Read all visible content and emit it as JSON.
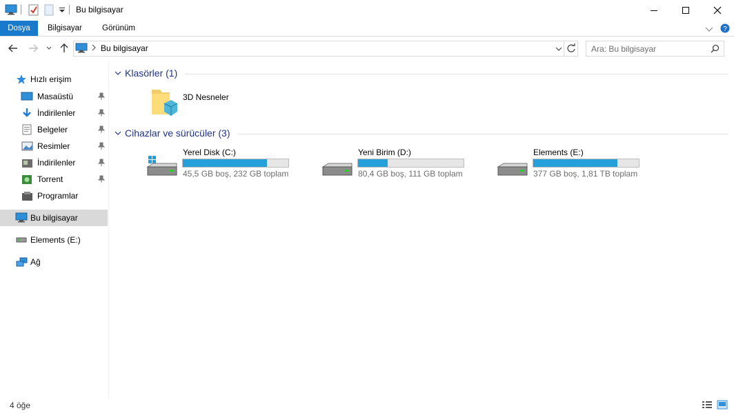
{
  "window": {
    "title": "Bu bilgisayar"
  },
  "ribbon": {
    "tabs": [
      "Dosya",
      "Bilgisayar",
      "Görünüm"
    ]
  },
  "address": {
    "location": "Bu bilgisayar"
  },
  "search": {
    "placeholder": "Ara: Bu bilgisayar"
  },
  "sidebar": {
    "quick_access": "Hızlı erişim",
    "quick_items": [
      {
        "label": "Masaüstü",
        "icon": "desktop-icon"
      },
      {
        "label": "İndirilenler",
        "icon": "download-icon"
      },
      {
        "label": "Belgeler",
        "icon": "documents-icon"
      },
      {
        "label": "Resimler",
        "icon": "pictures-icon"
      },
      {
        "label": "İndirilenler",
        "icon": "downloads-folder-icon"
      },
      {
        "label": "Torrent",
        "icon": "torrent-folder-icon"
      },
      {
        "label": "Programlar",
        "icon": "programs-folder-icon"
      }
    ],
    "this_pc": "Bu bilgisayar",
    "drive": "Elements (E:)",
    "network": "Ağ"
  },
  "groups": {
    "folders": "Klasörler (1)",
    "devices": "Cihazlar ve sürücüler (3)"
  },
  "folders": [
    {
      "name": "3D Nesneler"
    }
  ],
  "drives": [
    {
      "name": "Yerel Disk (C:)",
      "info": "45,5 GB boş, 232 GB toplam",
      "used_fraction": 0.8
    },
    {
      "name": "Yeni Birim (D:)",
      "info": "80,4 GB boş, 111 GB toplam",
      "used_fraction": 0.28
    },
    {
      "name": "Elements (E:)",
      "info": "377 GB boş, 1,81 TB toplam",
      "used_fraction": 0.8
    }
  ],
  "status": {
    "count": "4 öğe"
  },
  "colors": {
    "accent": "#1979ca",
    "bar_fill": "#26a0da",
    "group_heading": "#1e3287"
  }
}
